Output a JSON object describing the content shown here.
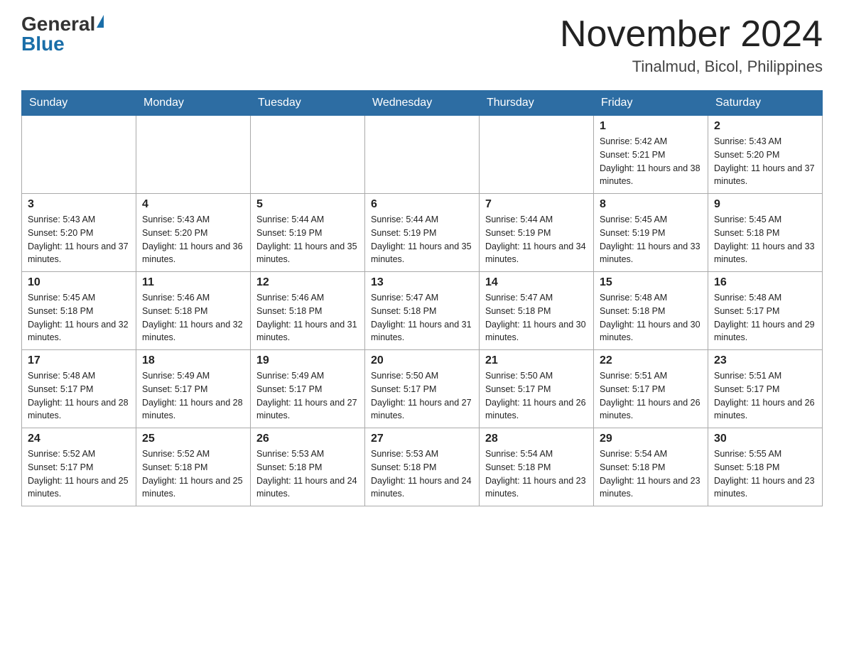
{
  "header": {
    "logo_general": "General",
    "logo_blue": "Blue",
    "month_title": "November 2024",
    "location": "Tinalmud, Bicol, Philippines"
  },
  "weekdays": [
    "Sunday",
    "Monday",
    "Tuesday",
    "Wednesday",
    "Thursday",
    "Friday",
    "Saturday"
  ],
  "weeks": [
    [
      {
        "day": "",
        "info": ""
      },
      {
        "day": "",
        "info": ""
      },
      {
        "day": "",
        "info": ""
      },
      {
        "day": "",
        "info": ""
      },
      {
        "day": "",
        "info": ""
      },
      {
        "day": "1",
        "info": "Sunrise: 5:42 AM\nSunset: 5:21 PM\nDaylight: 11 hours and 38 minutes."
      },
      {
        "day": "2",
        "info": "Sunrise: 5:43 AM\nSunset: 5:20 PM\nDaylight: 11 hours and 37 minutes."
      }
    ],
    [
      {
        "day": "3",
        "info": "Sunrise: 5:43 AM\nSunset: 5:20 PM\nDaylight: 11 hours and 37 minutes."
      },
      {
        "day": "4",
        "info": "Sunrise: 5:43 AM\nSunset: 5:20 PM\nDaylight: 11 hours and 36 minutes."
      },
      {
        "day": "5",
        "info": "Sunrise: 5:44 AM\nSunset: 5:19 PM\nDaylight: 11 hours and 35 minutes."
      },
      {
        "day": "6",
        "info": "Sunrise: 5:44 AM\nSunset: 5:19 PM\nDaylight: 11 hours and 35 minutes."
      },
      {
        "day": "7",
        "info": "Sunrise: 5:44 AM\nSunset: 5:19 PM\nDaylight: 11 hours and 34 minutes."
      },
      {
        "day": "8",
        "info": "Sunrise: 5:45 AM\nSunset: 5:19 PM\nDaylight: 11 hours and 33 minutes."
      },
      {
        "day": "9",
        "info": "Sunrise: 5:45 AM\nSunset: 5:18 PM\nDaylight: 11 hours and 33 minutes."
      }
    ],
    [
      {
        "day": "10",
        "info": "Sunrise: 5:45 AM\nSunset: 5:18 PM\nDaylight: 11 hours and 32 minutes."
      },
      {
        "day": "11",
        "info": "Sunrise: 5:46 AM\nSunset: 5:18 PM\nDaylight: 11 hours and 32 minutes."
      },
      {
        "day": "12",
        "info": "Sunrise: 5:46 AM\nSunset: 5:18 PM\nDaylight: 11 hours and 31 minutes."
      },
      {
        "day": "13",
        "info": "Sunrise: 5:47 AM\nSunset: 5:18 PM\nDaylight: 11 hours and 31 minutes."
      },
      {
        "day": "14",
        "info": "Sunrise: 5:47 AM\nSunset: 5:18 PM\nDaylight: 11 hours and 30 minutes."
      },
      {
        "day": "15",
        "info": "Sunrise: 5:48 AM\nSunset: 5:18 PM\nDaylight: 11 hours and 30 minutes."
      },
      {
        "day": "16",
        "info": "Sunrise: 5:48 AM\nSunset: 5:17 PM\nDaylight: 11 hours and 29 minutes."
      }
    ],
    [
      {
        "day": "17",
        "info": "Sunrise: 5:48 AM\nSunset: 5:17 PM\nDaylight: 11 hours and 28 minutes."
      },
      {
        "day": "18",
        "info": "Sunrise: 5:49 AM\nSunset: 5:17 PM\nDaylight: 11 hours and 28 minutes."
      },
      {
        "day": "19",
        "info": "Sunrise: 5:49 AM\nSunset: 5:17 PM\nDaylight: 11 hours and 27 minutes."
      },
      {
        "day": "20",
        "info": "Sunrise: 5:50 AM\nSunset: 5:17 PM\nDaylight: 11 hours and 27 minutes."
      },
      {
        "day": "21",
        "info": "Sunrise: 5:50 AM\nSunset: 5:17 PM\nDaylight: 11 hours and 26 minutes."
      },
      {
        "day": "22",
        "info": "Sunrise: 5:51 AM\nSunset: 5:17 PM\nDaylight: 11 hours and 26 minutes."
      },
      {
        "day": "23",
        "info": "Sunrise: 5:51 AM\nSunset: 5:17 PM\nDaylight: 11 hours and 26 minutes."
      }
    ],
    [
      {
        "day": "24",
        "info": "Sunrise: 5:52 AM\nSunset: 5:17 PM\nDaylight: 11 hours and 25 minutes."
      },
      {
        "day": "25",
        "info": "Sunrise: 5:52 AM\nSunset: 5:18 PM\nDaylight: 11 hours and 25 minutes."
      },
      {
        "day": "26",
        "info": "Sunrise: 5:53 AM\nSunset: 5:18 PM\nDaylight: 11 hours and 24 minutes."
      },
      {
        "day": "27",
        "info": "Sunrise: 5:53 AM\nSunset: 5:18 PM\nDaylight: 11 hours and 24 minutes."
      },
      {
        "day": "28",
        "info": "Sunrise: 5:54 AM\nSunset: 5:18 PM\nDaylight: 11 hours and 23 minutes."
      },
      {
        "day": "29",
        "info": "Sunrise: 5:54 AM\nSunset: 5:18 PM\nDaylight: 11 hours and 23 minutes."
      },
      {
        "day": "30",
        "info": "Sunrise: 5:55 AM\nSunset: 5:18 PM\nDaylight: 11 hours and 23 minutes."
      }
    ]
  ]
}
